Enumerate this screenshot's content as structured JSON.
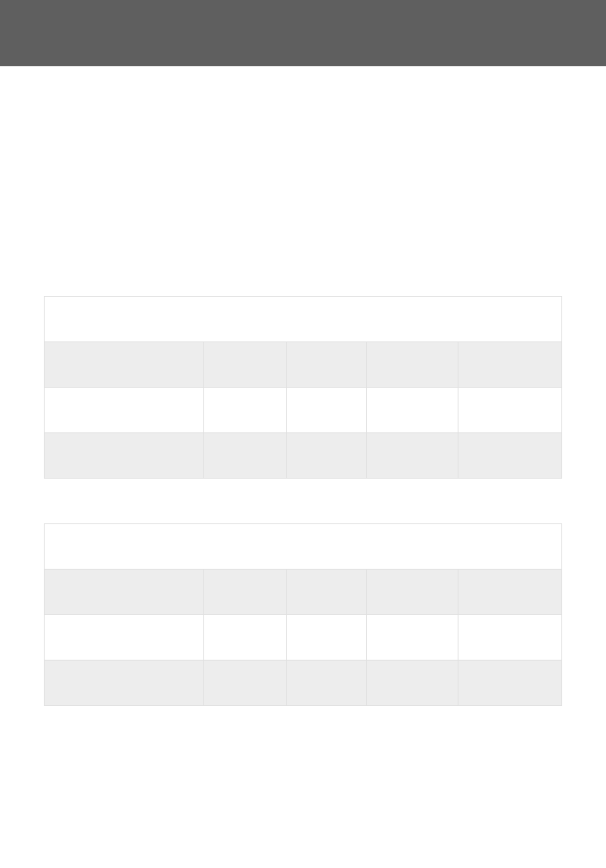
{
  "tables": [
    {
      "title_row": [
        ""
      ],
      "header_row": [
        "",
        "",
        "",
        "",
        ""
      ],
      "data_rows": [
        [
          "",
          "",
          "",
          "",
          ""
        ],
        [
          "",
          "",
          "",
          "",
          ""
        ]
      ]
    },
    {
      "title_row": [
        ""
      ],
      "header_row": [
        "",
        "",
        "",
        "",
        ""
      ],
      "data_rows": [
        [
          "",
          "",
          "",
          "",
          ""
        ],
        [
          "",
          "",
          "",
          "",
          ""
        ]
      ]
    }
  ]
}
